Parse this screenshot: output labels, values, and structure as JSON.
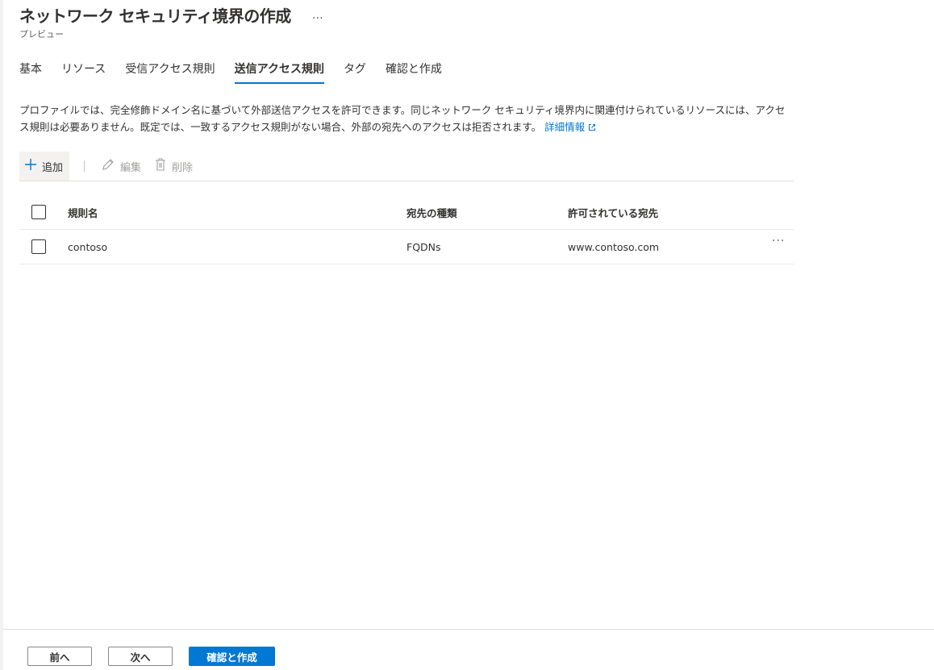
{
  "header": {
    "title": "ネットワーク セキュリティ境界の作成",
    "more": "…",
    "subtitle": "プレビュー"
  },
  "tabs": [
    {
      "label": "基本",
      "active": false
    },
    {
      "label": "リソース",
      "active": false
    },
    {
      "label": "受信アクセス規則",
      "active": false
    },
    {
      "label": "送信アクセス規則",
      "active": true
    },
    {
      "label": "タグ",
      "active": false
    },
    {
      "label": "確認と作成",
      "active": false
    }
  ],
  "description": {
    "text": "プロファイルでは、完全修飾ドメイン名に基づいて外部送信アクセスを許可できます。同じネットワーク セキュリティ境界内に関連付けられているリソースには、アクセス規則は必要ありません。既定では、一致するアクセス規則がない場合、外部の宛先へのアクセスは拒否されます。",
    "learn_more": "詳細情報"
  },
  "toolbar": {
    "add_label": "追加",
    "edit_label": "編集",
    "delete_label": "削除"
  },
  "table": {
    "columns": [
      "規則名",
      "宛先の種類",
      "許可されている宛先"
    ],
    "rows": [
      {
        "name": "contoso",
        "type": "FQDNs",
        "destination": "www.contoso.com",
        "more": "···"
      }
    ]
  },
  "footer": {
    "prev_label": "前へ",
    "next_label": "次へ",
    "review_label": "確認と作成"
  },
  "colors": {
    "accent": "#0078d4",
    "text": "#323130",
    "disabled": "#a19f9d"
  }
}
